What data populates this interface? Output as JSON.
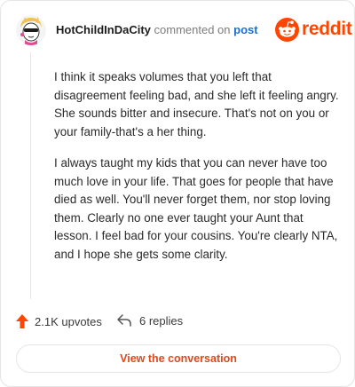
{
  "comment": {
    "username": "HotChildInDaCity",
    "action_text": "commented on",
    "post_link": "post",
    "paragraphs": [
      "I think it speaks volumes that you left that disagreement feeling bad, and she left it feeling angry. She sounds bitter and insecure. That's not on you or your family-that's a her thing.",
      "I always taught my kids that you can never have too much love in your life. That goes for people that have died as well. You'll never forget them, nor stop loving them. Clearly no one ever taught your Aunt that lesson. I feel bad for your cousins. You're clearly NTA, and I hope she gets some clarity."
    ]
  },
  "brand": {
    "wordmark": "reddit",
    "color": "#ff4500"
  },
  "stats": {
    "upvotes_label": "2.1K upvotes",
    "replies_label": "6 replies"
  },
  "cta": {
    "label": "View the conversation"
  },
  "icons": {
    "avatar": "avatar-icon",
    "logo": "reddit-alien-icon",
    "upvote": "upvote-arrow-icon",
    "reply": "reply-arrow-icon"
  }
}
